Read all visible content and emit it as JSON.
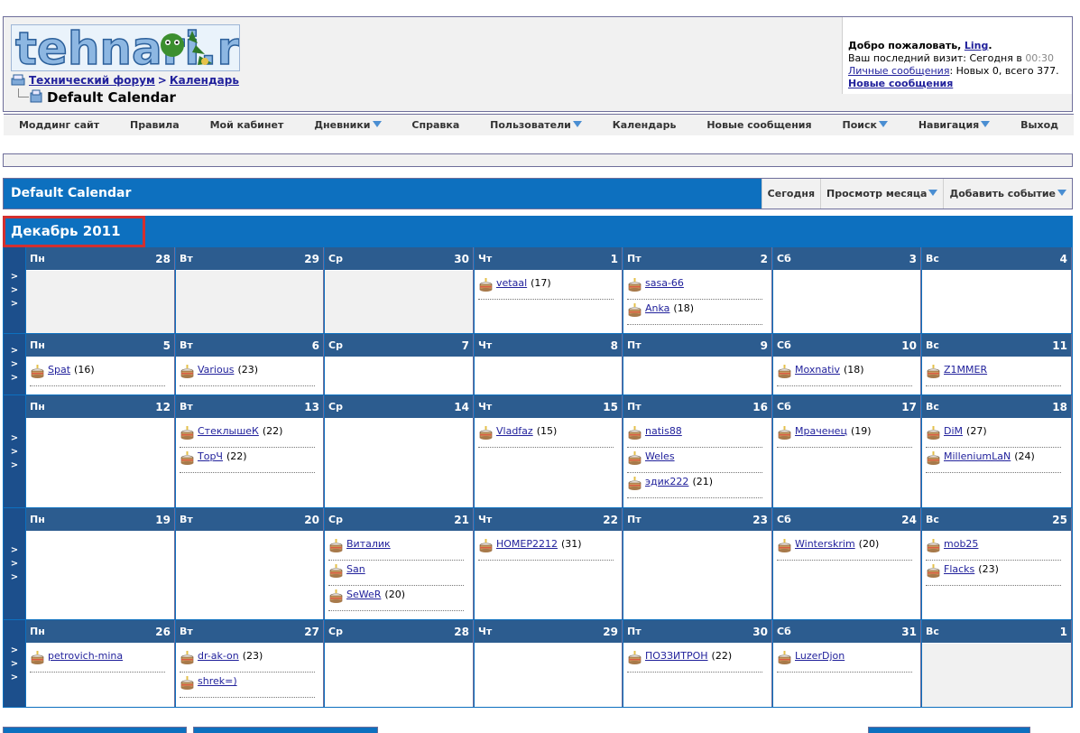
{
  "header": {
    "logo_text": "tehnari.ru",
    "breadcrumb": [
      {
        "label": "Технический форум"
      },
      {
        "label": "Календарь"
      }
    ],
    "breadcrumb_sep": ">",
    "page_title": "Default Calendar",
    "welcome": {
      "greeting": "Добро пожаловать,",
      "user": "Ling",
      "last_visit_prefix": "Ваш последний визит: Сегодня в",
      "last_visit_time": "00:30",
      "pm_label": "Личные сообщения",
      "pm_counts": ": Новых 0, всего 377.",
      "new_posts": "Новые сообщения"
    }
  },
  "nav": [
    {
      "label": "Моддинг сайт",
      "dropdown": false
    },
    {
      "label": "Правила",
      "dropdown": false
    },
    {
      "label": "Мой кабинет",
      "dropdown": false
    },
    {
      "label": "Дневники",
      "dropdown": true
    },
    {
      "label": "Справка",
      "dropdown": false
    },
    {
      "label": "Пользователи",
      "dropdown": true
    },
    {
      "label": "Календарь",
      "dropdown": false
    },
    {
      "label": "Новые сообщения",
      "dropdown": false
    },
    {
      "label": "Поиск",
      "dropdown": true
    },
    {
      "label": "Навигация",
      "dropdown": true
    },
    {
      "label": "Выход",
      "dropdown": false
    }
  ],
  "calendar": {
    "title": "Default Calendar",
    "tools": [
      {
        "label": "Сегодня",
        "dropdown": false
      },
      {
        "label": "Просмотр месяца",
        "dropdown": true
      },
      {
        "label": "Добавить событие",
        "dropdown": true
      }
    ],
    "month": "Декабрь 2011",
    "week_arrows": [
      ">",
      ">",
      ">"
    ],
    "weeks": [
      {
        "days": [
          {
            "wd": "Пн",
            "num": "28",
            "other": true,
            "events": []
          },
          {
            "wd": "Вт",
            "num": "29",
            "other": true,
            "events": []
          },
          {
            "wd": "Ср",
            "num": "30",
            "other": true,
            "events": []
          },
          {
            "wd": "Чт",
            "num": "1",
            "events": [
              {
                "name": "vetaal",
                "age": "(17)"
              }
            ]
          },
          {
            "wd": "Пт",
            "num": "2",
            "events": [
              {
                "name": "sasa-66",
                "age": ""
              },
              {
                "name": "Anka",
                "age": "(18)"
              }
            ]
          },
          {
            "wd": "Сб",
            "num": "3",
            "events": []
          },
          {
            "wd": "Вс",
            "num": "4",
            "events": []
          }
        ]
      },
      {
        "days": [
          {
            "wd": "Пн",
            "num": "5",
            "events": [
              {
                "name": "Spat",
                "age": "(16)"
              }
            ]
          },
          {
            "wd": "Вт",
            "num": "6",
            "events": [
              {
                "name": "Various",
                "age": "(23)"
              }
            ]
          },
          {
            "wd": "Ср",
            "num": "7",
            "events": []
          },
          {
            "wd": "Чт",
            "num": "8",
            "events": []
          },
          {
            "wd": "Пт",
            "num": "9",
            "events": []
          },
          {
            "wd": "Сб",
            "num": "10",
            "events": [
              {
                "name": "Moxnativ",
                "age": "(18)"
              }
            ]
          },
          {
            "wd": "Вс",
            "num": "11",
            "events": [
              {
                "name": "Z1MMER",
                "age": ""
              }
            ]
          }
        ]
      },
      {
        "days": [
          {
            "wd": "Пн",
            "num": "12",
            "events": []
          },
          {
            "wd": "Вт",
            "num": "13",
            "events": [
              {
                "name": "СтеклышеК",
                "age": "(22)"
              },
              {
                "name": "ТорЧ",
                "age": "(22)"
              }
            ]
          },
          {
            "wd": "Ср",
            "num": "14",
            "events": []
          },
          {
            "wd": "Чт",
            "num": "15",
            "events": [
              {
                "name": "Vladfaz",
                "age": "(15)"
              }
            ]
          },
          {
            "wd": "Пт",
            "num": "16",
            "events": [
              {
                "name": "natis88",
                "age": ""
              },
              {
                "name": "Weles",
                "age": ""
              },
              {
                "name": "эдик222",
                "age": "(21)"
              }
            ]
          },
          {
            "wd": "Сб",
            "num": "17",
            "events": [
              {
                "name": "Мраченец",
                "age": "(19)"
              }
            ]
          },
          {
            "wd": "Вс",
            "num": "18",
            "events": [
              {
                "name": "DiM",
                "age": "(27)"
              },
              {
                "name": "MilleniumLaN",
                "age": "(24)"
              }
            ]
          }
        ]
      },
      {
        "days": [
          {
            "wd": "Пн",
            "num": "19",
            "events": []
          },
          {
            "wd": "Вт",
            "num": "20",
            "events": []
          },
          {
            "wd": "Ср",
            "num": "21",
            "events": [
              {
                "name": "Виталик",
                "age": ""
              },
              {
                "name": "San",
                "age": ""
              },
              {
                "name": "SeWeR",
                "age": "(20)"
              }
            ]
          },
          {
            "wd": "Чт",
            "num": "22",
            "events": [
              {
                "name": "HOMEP2212",
                "age": "(31)"
              }
            ]
          },
          {
            "wd": "Пт",
            "num": "23",
            "events": []
          },
          {
            "wd": "Сб",
            "num": "24",
            "events": [
              {
                "name": "Winterskrim",
                "age": "(20)"
              }
            ]
          },
          {
            "wd": "Вс",
            "num": "25",
            "events": [
              {
                "name": "mob25",
                "age": ""
              },
              {
                "name": "Flacks",
                "age": "(23)"
              }
            ]
          }
        ]
      },
      {
        "days": [
          {
            "wd": "Пн",
            "num": "26",
            "events": [
              {
                "name": "petrovich-mina",
                "age": ""
              }
            ]
          },
          {
            "wd": "Вт",
            "num": "27",
            "events": [
              {
                "name": "dr-ak-on",
                "age": "(23)"
              },
              {
                "name": "shrek=)",
                "age": ""
              }
            ]
          },
          {
            "wd": "Ср",
            "num": "28",
            "events": []
          },
          {
            "wd": "Чт",
            "num": "29",
            "events": []
          },
          {
            "wd": "Пт",
            "num": "30",
            "events": [
              {
                "name": "ПОЗЗИТРОН",
                "age": "(22)"
              }
            ]
          },
          {
            "wd": "Сб",
            "num": "31",
            "events": [
              {
                "name": "LuzerDjon",
                "age": ""
              }
            ]
          },
          {
            "wd": "Вс",
            "num": "1",
            "other": true,
            "events": []
          }
        ]
      }
    ]
  },
  "colors": {
    "accent_blue": "#0d70bf",
    "day_header": "#2c5c8f",
    "week_button": "#1c4f8c",
    "link": "#22229c",
    "highlight_red": "#d32f2f"
  }
}
